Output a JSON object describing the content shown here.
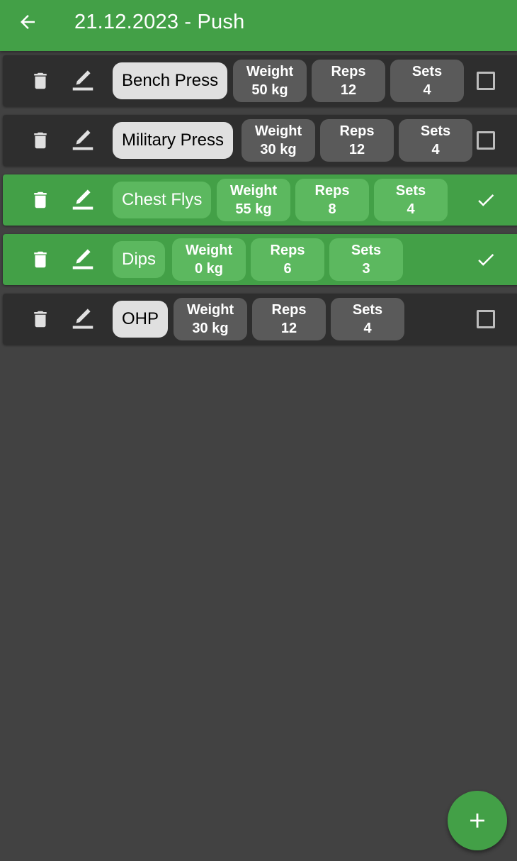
{
  "app_bar": {
    "title": "21.12.2023 - Push",
    "back_icon": "arrow-left-icon",
    "color": "#43a047"
  },
  "exercises": [
    {
      "name": "Bench Press",
      "weight_label": "Weight",
      "weight": "50 kg",
      "reps_label": "Reps",
      "reps": "12",
      "sets_label": "Sets",
      "sets": "4",
      "done": false
    },
    {
      "name": "Military Press",
      "weight_label": "Weight",
      "weight": "30 kg",
      "reps_label": "Reps",
      "reps": "12",
      "sets_label": "Sets",
      "sets": "4",
      "done": false
    },
    {
      "name": "Chest Flys",
      "weight_label": "Weight",
      "weight": "55 kg",
      "reps_label": "Reps",
      "reps": "8",
      "sets_label": "Sets",
      "sets": "4",
      "done": true
    },
    {
      "name": "Dips",
      "weight_label": "Weight",
      "weight": "0 kg",
      "reps_label": "Reps",
      "reps": "6",
      "sets_label": "Sets",
      "sets": "3",
      "done": true
    },
    {
      "name": "OHP",
      "weight_label": "Weight",
      "weight": "30 kg",
      "reps_label": "Reps",
      "reps": "12",
      "sets_label": "Sets",
      "sets": "4",
      "done": false
    }
  ],
  "row_icons": {
    "delete": "trash-icon",
    "edit": "pencil-icon"
  },
  "colors": {
    "done_row": "#43a047",
    "pending_row": "#2e2e2e",
    "background": "#424242"
  },
  "fab": {
    "icon": "plus-icon"
  }
}
